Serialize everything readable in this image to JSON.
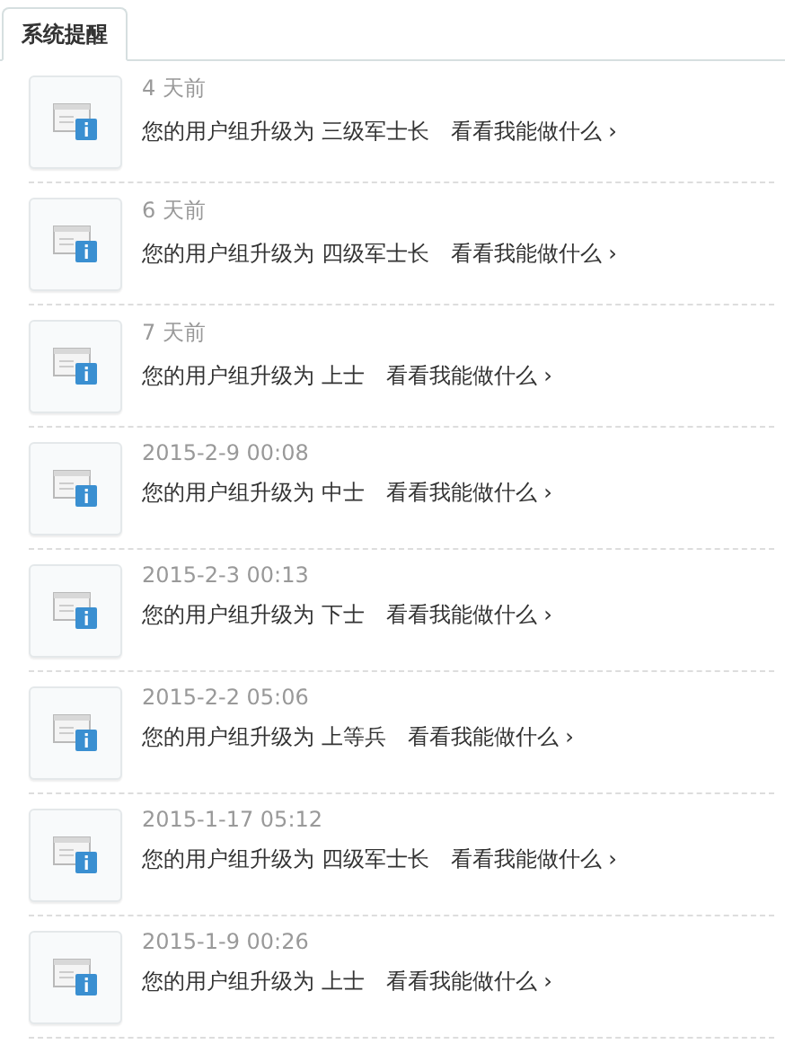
{
  "tabs": [
    {
      "label": "系统提醒",
      "selected": true
    }
  ],
  "notices": [
    {
      "time": "4 天前",
      "message": "您的用户组升级为 三级军士长",
      "link": "看看我能做什么 ›"
    },
    {
      "time": "6 天前",
      "message": "您的用户组升级为 四级军士长",
      "link": "看看我能做什么 ›"
    },
    {
      "time": "7 天前",
      "message": "您的用户组升级为 上士",
      "link": "看看我能做什么 ›"
    },
    {
      "time": "2015-2-9 00:08",
      "message": "您的用户组升级为 中士",
      "link": "看看我能做什么 ›"
    },
    {
      "time": "2015-2-3 00:13",
      "message": "您的用户组升级为 下士",
      "link": "看看我能做什么 ›"
    },
    {
      "time": "2015-2-2 05:06",
      "message": "您的用户组升级为 上等兵",
      "link": "看看我能做什么 ›"
    },
    {
      "time": "2015-1-17 05:12",
      "message": "您的用户组升级为 四级军士长",
      "link": "看看我能做什么 ›"
    },
    {
      "time": "2015-1-9 00:26",
      "message": "您的用户组升级为 上士",
      "link": "看看我能做什么 ›"
    }
  ]
}
